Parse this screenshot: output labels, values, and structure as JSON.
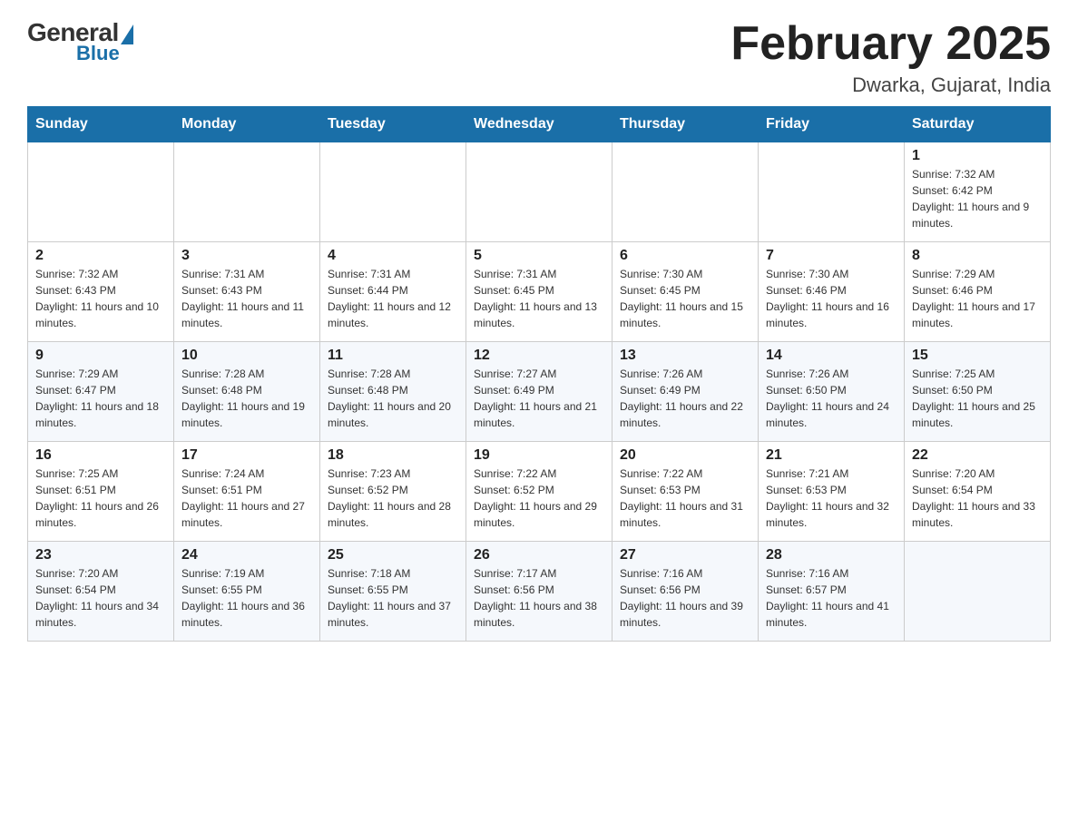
{
  "logo": {
    "general": "General",
    "blue": "Blue"
  },
  "header": {
    "title": "February 2025",
    "subtitle": "Dwarka, Gujarat, India"
  },
  "weekdays": [
    "Sunday",
    "Monday",
    "Tuesday",
    "Wednesday",
    "Thursday",
    "Friday",
    "Saturday"
  ],
  "weeks": [
    [
      {
        "day": "",
        "info": ""
      },
      {
        "day": "",
        "info": ""
      },
      {
        "day": "",
        "info": ""
      },
      {
        "day": "",
        "info": ""
      },
      {
        "day": "",
        "info": ""
      },
      {
        "day": "",
        "info": ""
      },
      {
        "day": "1",
        "info": "Sunrise: 7:32 AM\nSunset: 6:42 PM\nDaylight: 11 hours and 9 minutes."
      }
    ],
    [
      {
        "day": "2",
        "info": "Sunrise: 7:32 AM\nSunset: 6:43 PM\nDaylight: 11 hours and 10 minutes."
      },
      {
        "day": "3",
        "info": "Sunrise: 7:31 AM\nSunset: 6:43 PM\nDaylight: 11 hours and 11 minutes."
      },
      {
        "day": "4",
        "info": "Sunrise: 7:31 AM\nSunset: 6:44 PM\nDaylight: 11 hours and 12 minutes."
      },
      {
        "day": "5",
        "info": "Sunrise: 7:31 AM\nSunset: 6:45 PM\nDaylight: 11 hours and 13 minutes."
      },
      {
        "day": "6",
        "info": "Sunrise: 7:30 AM\nSunset: 6:45 PM\nDaylight: 11 hours and 15 minutes."
      },
      {
        "day": "7",
        "info": "Sunrise: 7:30 AM\nSunset: 6:46 PM\nDaylight: 11 hours and 16 minutes."
      },
      {
        "day": "8",
        "info": "Sunrise: 7:29 AM\nSunset: 6:46 PM\nDaylight: 11 hours and 17 minutes."
      }
    ],
    [
      {
        "day": "9",
        "info": "Sunrise: 7:29 AM\nSunset: 6:47 PM\nDaylight: 11 hours and 18 minutes."
      },
      {
        "day": "10",
        "info": "Sunrise: 7:28 AM\nSunset: 6:48 PM\nDaylight: 11 hours and 19 minutes."
      },
      {
        "day": "11",
        "info": "Sunrise: 7:28 AM\nSunset: 6:48 PM\nDaylight: 11 hours and 20 minutes."
      },
      {
        "day": "12",
        "info": "Sunrise: 7:27 AM\nSunset: 6:49 PM\nDaylight: 11 hours and 21 minutes."
      },
      {
        "day": "13",
        "info": "Sunrise: 7:26 AM\nSunset: 6:49 PM\nDaylight: 11 hours and 22 minutes."
      },
      {
        "day": "14",
        "info": "Sunrise: 7:26 AM\nSunset: 6:50 PM\nDaylight: 11 hours and 24 minutes."
      },
      {
        "day": "15",
        "info": "Sunrise: 7:25 AM\nSunset: 6:50 PM\nDaylight: 11 hours and 25 minutes."
      }
    ],
    [
      {
        "day": "16",
        "info": "Sunrise: 7:25 AM\nSunset: 6:51 PM\nDaylight: 11 hours and 26 minutes."
      },
      {
        "day": "17",
        "info": "Sunrise: 7:24 AM\nSunset: 6:51 PM\nDaylight: 11 hours and 27 minutes."
      },
      {
        "day": "18",
        "info": "Sunrise: 7:23 AM\nSunset: 6:52 PM\nDaylight: 11 hours and 28 minutes."
      },
      {
        "day": "19",
        "info": "Sunrise: 7:22 AM\nSunset: 6:52 PM\nDaylight: 11 hours and 29 minutes."
      },
      {
        "day": "20",
        "info": "Sunrise: 7:22 AM\nSunset: 6:53 PM\nDaylight: 11 hours and 31 minutes."
      },
      {
        "day": "21",
        "info": "Sunrise: 7:21 AM\nSunset: 6:53 PM\nDaylight: 11 hours and 32 minutes."
      },
      {
        "day": "22",
        "info": "Sunrise: 7:20 AM\nSunset: 6:54 PM\nDaylight: 11 hours and 33 minutes."
      }
    ],
    [
      {
        "day": "23",
        "info": "Sunrise: 7:20 AM\nSunset: 6:54 PM\nDaylight: 11 hours and 34 minutes."
      },
      {
        "day": "24",
        "info": "Sunrise: 7:19 AM\nSunset: 6:55 PM\nDaylight: 11 hours and 36 minutes."
      },
      {
        "day": "25",
        "info": "Sunrise: 7:18 AM\nSunset: 6:55 PM\nDaylight: 11 hours and 37 minutes."
      },
      {
        "day": "26",
        "info": "Sunrise: 7:17 AM\nSunset: 6:56 PM\nDaylight: 11 hours and 38 minutes."
      },
      {
        "day": "27",
        "info": "Sunrise: 7:16 AM\nSunset: 6:56 PM\nDaylight: 11 hours and 39 minutes."
      },
      {
        "day": "28",
        "info": "Sunrise: 7:16 AM\nSunset: 6:57 PM\nDaylight: 11 hours and 41 minutes."
      },
      {
        "day": "",
        "info": ""
      }
    ]
  ]
}
